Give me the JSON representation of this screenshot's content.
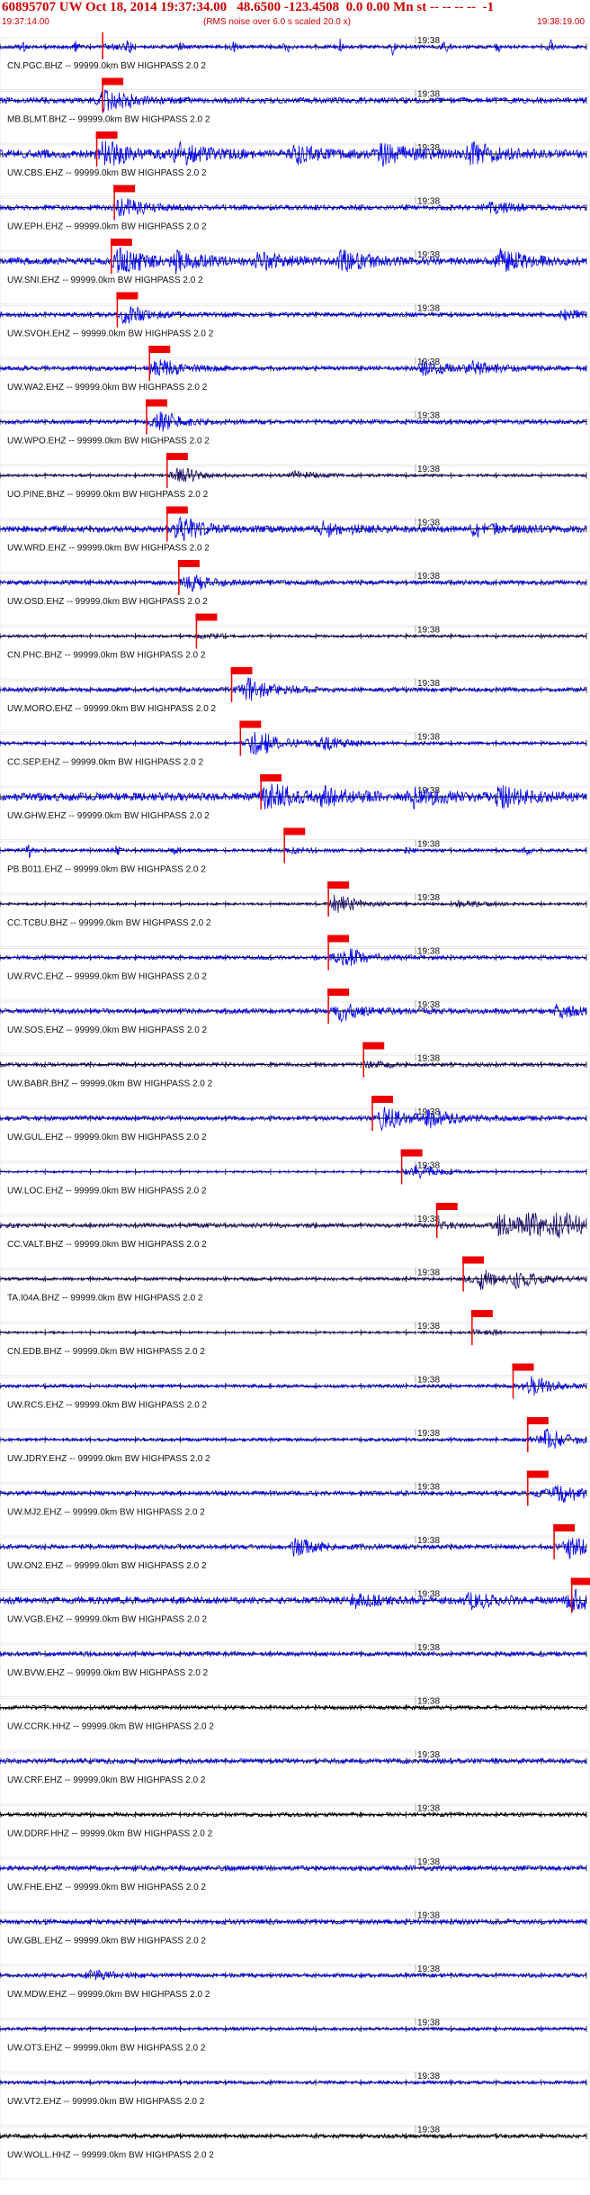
{
  "header": {
    "title": "60895707 UW Oct 18, 2014 19:37:34.00   48.6500 -123.4508  0.0 0.00 Mn st -- -- -- --  -1",
    "start_time": "19:37:14.00",
    "note": "(RMS noise over 6.0 s scaled 20.0 x)",
    "end_time": "19:38:19.00"
  },
  "colors": {
    "trace_blue": "#0000ee",
    "trace_dark": "#1a0a66",
    "trace_black": "#000000",
    "pick": "#ee0000",
    "axis": "#000000"
  },
  "chart_data": {
    "type": "helicorder",
    "x_start": "19:37:14.00",
    "x_end": "19:38:19.00",
    "minute_mark": "19:38",
    "minute_mark_fraction": 0.708,
    "traces": [
      {
        "label": "CN.PGC.BHZ -- 99999.0km BW  HIGHPASS  2.0  2",
        "color": "blue",
        "pick": 0.175,
        "amp": 0.15,
        "events": [
          [
            0.04,
            0.6
          ],
          [
            0.13,
            0.6
          ],
          [
            0.22,
            0.6
          ],
          [
            0.31,
            0.6
          ],
          [
            0.4,
            0.6
          ],
          [
            0.49,
            0.6
          ],
          [
            0.58,
            0.6
          ],
          [
            0.67,
            0.6
          ],
          [
            0.76,
            0.6
          ],
          [
            0.85,
            0.6
          ],
          [
            0.94,
            0.6
          ]
        ],
        "spiky": true
      },
      {
        "label": "MB.BLMT.BHZ -- 99999.0km BW  HIGHPASS  2.0  2",
        "color": "blue",
        "pick": 0.175,
        "amp": 0.25,
        "events": [
          [
            0.17,
            0.7
          ]
        ]
      },
      {
        "label": "UW.CBS.EHZ -- 99999.0km BW  HIGHPASS  2.0  2",
        "color": "blue",
        "pick": 0.165,
        "amp": 0.35,
        "events": [
          [
            0.17,
            0.9
          ],
          [
            0.3,
            0.9
          ],
          [
            0.5,
            0.8
          ],
          [
            0.65,
            0.85
          ],
          [
            0.8,
            0.9
          ]
        ]
      },
      {
        "label": "UW.EPH.EHZ -- 99999.0km BW  HIGHPASS  2.0  2",
        "color": "blue",
        "pick": 0.195,
        "amp": 0.22,
        "events": [
          [
            0.2,
            0.6
          ],
          [
            0.83,
            0.5
          ]
        ]
      },
      {
        "label": "UW.SNI.EHZ -- 99999.0km BW  HIGHPASS  2.0  2",
        "color": "blue",
        "pick": 0.19,
        "amp": 0.3,
        "events": [
          [
            0.2,
            0.9
          ],
          [
            0.3,
            0.8
          ],
          [
            0.44,
            0.7
          ],
          [
            0.58,
            0.9
          ],
          [
            0.85,
            1.0
          ]
        ]
      },
      {
        "label": "UW.SVOH.EHZ -- 99999.0km BW  HIGHPASS  2.0  2",
        "color": "blue",
        "pick": 0.2,
        "amp": 0.2,
        "events": [
          [
            0.21,
            0.5
          ],
          [
            0.96,
            0.4
          ]
        ]
      },
      {
        "label": "UW.WA2.EHZ -- 99999.0km BW  HIGHPASS  2.0  2",
        "color": "blue",
        "pick": 0.255,
        "amp": 0.2,
        "events": [
          [
            0.26,
            0.6
          ],
          [
            0.72,
            0.6
          ],
          [
            0.8,
            0.5
          ]
        ]
      },
      {
        "label": "UW.WPO.EHZ -- 99999.0km BW  HIGHPASS  2.0  2",
        "color": "blue",
        "pick": 0.25,
        "amp": 0.2,
        "events": [
          [
            0.27,
            0.6
          ]
        ]
      },
      {
        "label": "UO.PINE.BHZ -- 99999.0km BW  HIGHPASS  2.0  2",
        "color": "dark",
        "pick": 0.285,
        "amp": 0.12,
        "events": [
          [
            0.3,
            0.5
          ],
          [
            0.5,
            0.3
          ]
        ]
      },
      {
        "label": "UW.WRD.EHZ -- 99999.0km BW  HIGHPASS  2.0  2",
        "color": "blue",
        "pick": 0.285,
        "amp": 0.28,
        "events": [
          [
            0.3,
            0.8
          ],
          [
            0.55,
            0.6
          ],
          [
            0.8,
            0.6
          ]
        ]
      },
      {
        "label": "UW.OSD.EHZ -- 99999.0km BW  HIGHPASS  2.0  2",
        "color": "blue",
        "pick": 0.305,
        "amp": 0.2,
        "events": [
          [
            0.32,
            0.5
          ]
        ]
      },
      {
        "label": "CN.PHC.BHZ -- 99999.0km BW  HIGHPASS  2.0  2",
        "color": "dark",
        "pick": 0.335,
        "amp": 0.12,
        "events": []
      },
      {
        "label": "UW.MORO.EHZ -- 99999.0km BW  HIGHPASS  2.0  2",
        "color": "blue",
        "pick": 0.395,
        "amp": 0.2,
        "events": [
          [
            0.42,
            0.8
          ]
        ]
      },
      {
        "label": "CC.SEP.EHZ -- 99999.0km BW  HIGHPASS  2.0  2",
        "color": "blue",
        "pick": 0.41,
        "amp": 0.15,
        "events": [
          [
            0.43,
            1.0
          ],
          [
            0.55,
            0.5
          ]
        ]
      },
      {
        "label": "UW.GHW.EHZ -- 99999.0km BW  HIGHPASS  2.0  2",
        "color": "blue",
        "pick": 0.445,
        "amp": 0.35,
        "events": [
          [
            0.45,
            1.0
          ],
          [
            0.55,
            0.8
          ],
          [
            0.7,
            0.8
          ],
          [
            0.85,
            0.8
          ]
        ]
      },
      {
        "label": "PB.B011.EHZ -- 99999.0km BW  HIGHPASS  2.0  2",
        "color": "blue",
        "pick": 0.485,
        "amp": 0.15,
        "events": [
          [
            0.05,
            0.6
          ],
          [
            0.2,
            0.5
          ],
          [
            0.3,
            0.5
          ],
          [
            0.7,
            0.6
          ],
          [
            0.9,
            0.5
          ]
        ],
        "spiky": true
      },
      {
        "label": "CC.TCBU.BHZ -- 99999.0km BW  HIGHPASS  2.0  2",
        "color": "dark",
        "pick": 0.56,
        "amp": 0.1,
        "events": [
          [
            0.57,
            0.6
          ],
          [
            0.78,
            0.3
          ]
        ]
      },
      {
        "label": "UW.RVC.EHZ -- 99999.0km BW  HIGHPASS  2.0  2",
        "color": "blue",
        "pick": 0.56,
        "amp": 0.18,
        "events": [
          [
            0.58,
            0.7
          ]
        ]
      },
      {
        "label": "UW.SOS.EHZ -- 99999.0km BW  HIGHPASS  2.0  2",
        "color": "blue",
        "pick": 0.56,
        "amp": 0.22,
        "events": [
          [
            0.58,
            0.6
          ],
          [
            0.95,
            0.6
          ]
        ]
      },
      {
        "label": "UW.BABR.BHZ -- 99999.0km BW  HIGHPASS  2.0  2",
        "color": "dark",
        "pick": 0.62,
        "amp": 0.18,
        "events": []
      },
      {
        "label": "UW.GUL.EHZ -- 99999.0km BW  HIGHPASS  2.0  2",
        "color": "blue",
        "pick": 0.635,
        "amp": 0.2,
        "events": [
          [
            0.65,
            0.8
          ],
          [
            0.73,
            0.6
          ]
        ]
      },
      {
        "label": "UW.LOC.EHZ -- 99999.0km BW  HIGHPASS  2.0  2",
        "color": "blue",
        "pick": 0.685,
        "amp": 0.08,
        "events": [
          [
            0.71,
            0.5
          ]
        ]
      },
      {
        "label": "CC.VALT.BHZ -- 99999.0km BW  HIGHPASS  2.0  2",
        "color": "dark",
        "pick": 0.745,
        "amp": 0.2,
        "events": [
          [
            0.85,
            1.0
          ],
          [
            0.9,
            1.0
          ],
          [
            0.95,
            1.0
          ]
        ]
      },
      {
        "label": "TA.I04A.BHZ -- 99999.0km BW  HIGHPASS  2.0  2",
        "color": "dark",
        "pick": 0.79,
        "amp": 0.15,
        "events": [
          [
            0.82,
            0.7
          ],
          [
            0.88,
            0.6
          ]
        ]
      },
      {
        "label": "CN.EDB.BHZ -- 99999.0km BW  HIGHPASS  2.0  2",
        "color": "dark",
        "pick": 0.805,
        "amp": 0.1,
        "events": []
      },
      {
        "label": "UW.RCS.EHZ -- 99999.0km BW  HIGHPASS  2.0  2",
        "color": "blue",
        "pick": 0.875,
        "amp": 0.15,
        "events": [
          [
            0.9,
            0.7
          ]
        ]
      },
      {
        "label": "UW.JDRY.EHZ -- 99999.0km BW  HIGHPASS  2.0  2",
        "color": "blue",
        "pick": 0.9,
        "amp": 0.15,
        "events": [
          [
            0.93,
            0.7
          ]
        ]
      },
      {
        "label": "UW.MJ2.EHZ -- 99999.0km BW  HIGHPASS  2.0  2",
        "color": "blue",
        "pick": 0.9,
        "amp": 0.2,
        "events": [
          [
            0.95,
            0.9
          ]
        ]
      },
      {
        "label": "UW.ON2.EHZ -- 99999.0km BW  HIGHPASS  2.0  2",
        "color": "blue",
        "pick": 0.945,
        "amp": 0.2,
        "events": [
          [
            0.5,
            0.7
          ],
          [
            0.97,
            0.7
          ]
        ]
      },
      {
        "label": "UW.VGB.EHZ -- 99999.0km BW  HIGHPASS  2.0  2",
        "color": "blue",
        "pick": 0.975,
        "amp": 0.3,
        "events": [
          [
            0.6,
            0.6
          ],
          [
            0.8,
            0.7
          ],
          [
            0.97,
            0.8
          ]
        ]
      },
      {
        "label": "UW.BVW.EHZ -- 99999.0km BW  HIGHPASS  2.0  2",
        "color": "blue",
        "pick": null,
        "amp": 0.2,
        "events": []
      },
      {
        "label": "UW.CCRK.HHZ -- 99999.0km BW  HIGHPASS  2.0  2",
        "color": "black",
        "pick": null,
        "amp": 0.18,
        "events": []
      },
      {
        "label": "UW.CRF.EHZ -- 99999.0km BW  HIGHPASS  2.0  2",
        "color": "blue",
        "pick": null,
        "amp": 0.22,
        "events": []
      },
      {
        "label": "UW.DDRF.HHZ -- 99999.0km BW  HIGHPASS  2.0  2",
        "color": "black",
        "pick": null,
        "amp": 0.18,
        "events": []
      },
      {
        "label": "UW.FHE.EHZ -- 99999.0km BW  HIGHPASS  2.0  2",
        "color": "blue",
        "pick": null,
        "amp": 0.22,
        "events": []
      },
      {
        "label": "UW.GBL.EHZ -- 99999.0km BW  HIGHPASS  2.0  2",
        "color": "blue",
        "pick": null,
        "amp": 0.22,
        "events": []
      },
      {
        "label": "UW.MDW.EHZ -- 99999.0km BW  HIGHPASS  2.0  2",
        "color": "blue",
        "pick": null,
        "amp": 0.18,
        "events": [
          [
            0.15,
            0.4
          ]
        ]
      },
      {
        "label": "UW.OT3.EHZ -- 99999.0km BW  HIGHPASS  2.0  2",
        "color": "blue",
        "pick": null,
        "amp": 0.15,
        "events": []
      },
      {
        "label": "UW.VT2.EHZ -- 99999.0km BW  HIGHPASS  2.0  2",
        "color": "blue",
        "pick": null,
        "amp": 0.15,
        "events": []
      },
      {
        "label": "UW.WOLL.HHZ -- 99999.0km BW  HIGHPASS  2.0  2",
        "color": "black",
        "pick": null,
        "amp": 0.18,
        "events": []
      }
    ]
  }
}
